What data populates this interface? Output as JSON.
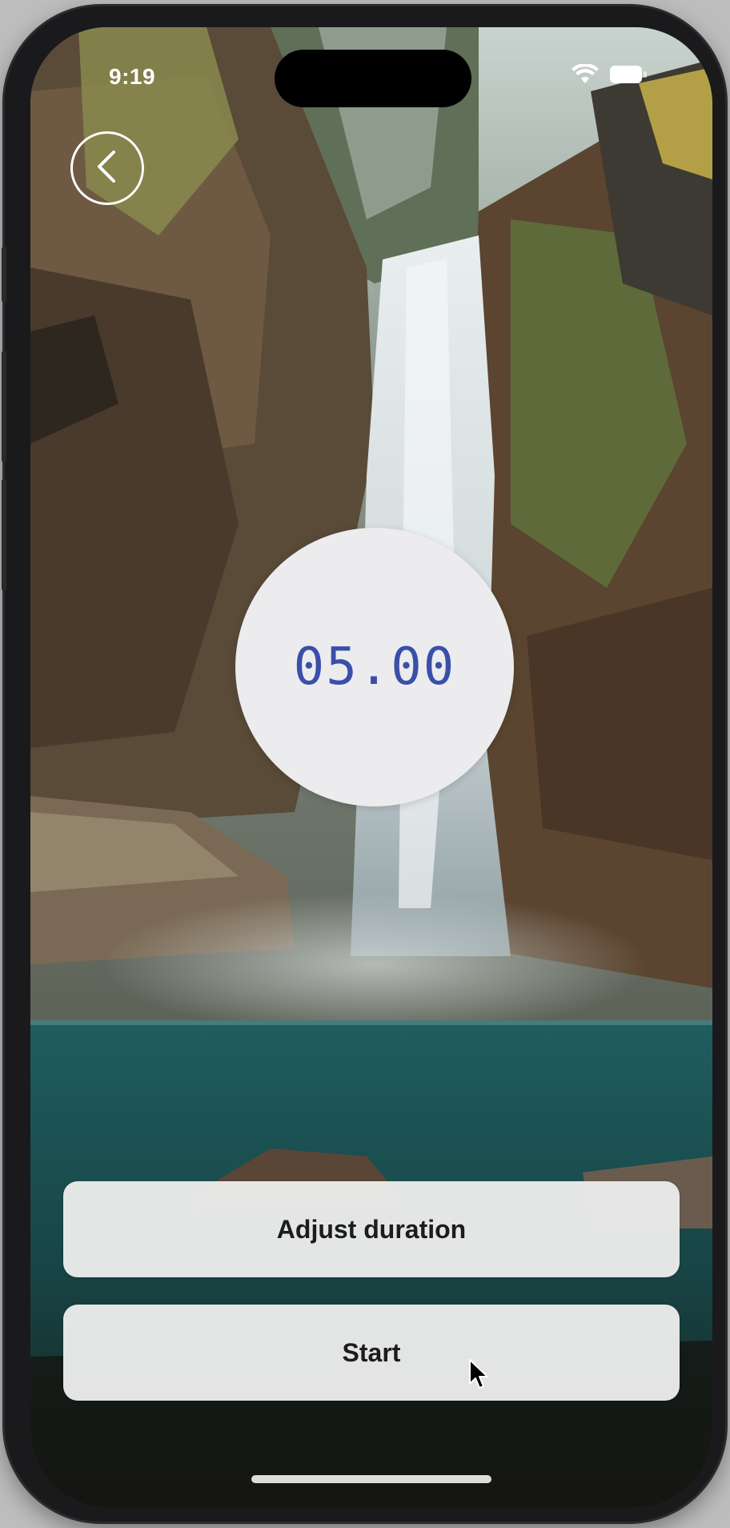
{
  "status_bar": {
    "time": "9:19",
    "icons": [
      "wifi-icon",
      "battery-icon"
    ]
  },
  "navigation": {
    "back_icon": "chevron-left-icon"
  },
  "timer": {
    "display": "05.00",
    "color": "#3a4fa8"
  },
  "actions": {
    "adjust_label": "Adjust duration",
    "start_label": "Start"
  },
  "background": {
    "icon": "waterfall-image"
  }
}
